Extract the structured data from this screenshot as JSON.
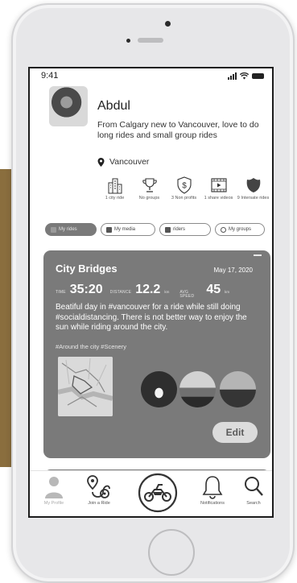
{
  "status_bar": {
    "time": "9:41"
  },
  "profile": {
    "name": "Abdul",
    "bio": "From Calgary new  to Vancouver, love to do long rides and small group rides",
    "location": "Vancouver"
  },
  "badges": [
    {
      "icon": "city-buildings-icon",
      "label": "1 city ride"
    },
    {
      "icon": "trophy-icon",
      "label": "No groups"
    },
    {
      "icon": "dollar-shield-icon",
      "label": "3 Non profits"
    },
    {
      "icon": "video-icon",
      "label": "1 share videos"
    },
    {
      "icon": "interstate-shield-icon",
      "label": "9 Intersate rides"
    }
  ],
  "filters": [
    {
      "label": "My rides",
      "icon": "ride-icon",
      "active": true
    },
    {
      "label": "My media",
      "icon": "camera-icon",
      "active": false
    },
    {
      "label": "riders",
      "icon": "riders-icon",
      "active": false
    },
    {
      "label": "My groups",
      "icon": "group-icon",
      "active": false
    }
  ],
  "ride_card": {
    "title": "City Bridges",
    "date": "May 17, 2020",
    "time_label": "TIME",
    "time_value": "35:20",
    "distance_label": "DISTANCE",
    "distance_value": "12.2",
    "distance_unit": "km",
    "speed_label": "AVG SPEED",
    "speed_value": "45",
    "speed_unit": "km",
    "description": "Beatiful day in #vancouver for a ride while still doing  #socialdistancing. There is not better way to enjoy the sun while riding around the city.",
    "tags": "#Around the city #Scenery",
    "edit_label": "Edit"
  },
  "tab_bar": [
    {
      "label": "My Profile",
      "icon": "profile-icon"
    },
    {
      "label": "Join a Ride",
      "icon": "route-pin-icon"
    },
    {
      "label": "",
      "icon": "motorcycle-icon"
    },
    {
      "label": "Notifications",
      "icon": "bell-icon"
    },
    {
      "label": "Search",
      "icon": "search-icon"
    }
  ],
  "colors": {
    "card": "#7a7a7a",
    "active_chip": "#7a7a7a",
    "accent_side": "#8a6e3e"
  }
}
